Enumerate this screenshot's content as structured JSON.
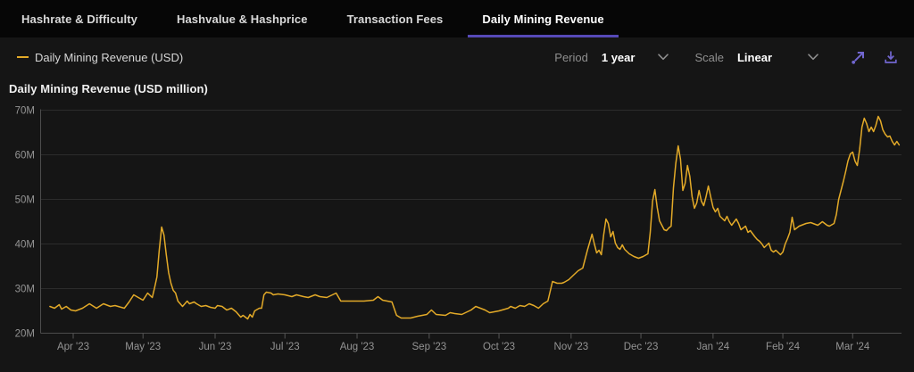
{
  "tabs": [
    {
      "label": "Hashrate & Difficulty",
      "active": false
    },
    {
      "label": "Hashvalue & Hashprice",
      "active": false
    },
    {
      "label": "Transaction Fees",
      "active": false
    },
    {
      "label": "Daily Mining Revenue",
      "active": true
    }
  ],
  "controls": {
    "period_label": "Period",
    "period_value": "1 year",
    "scale_label": "Scale",
    "scale_value": "Linear"
  },
  "colors": {
    "accent_purple": "#5649b8",
    "icon_purple": "#7166cf",
    "line_gold": "#e3aa28",
    "tabbar_bg": "#060606",
    "page_bg": "#151515",
    "grid": "#2c2c2c",
    "axis": "#4c4c4c",
    "tick": "#565656",
    "axis_text": "#949494"
  },
  "chart_data": {
    "type": "line",
    "title": "Daily Mining Revenue (USD million)",
    "series_name": "Daily Mining Revenue (USD)",
    "line_color": "#e3aa28",
    "y_unit": "USD million",
    "ylim": [
      20,
      70
    ],
    "grid": "horizontal-only",
    "legend_position": "top-left",
    "y_ticks": [
      {
        "label": "70M",
        "value": 70
      },
      {
        "label": "60M",
        "value": 60
      },
      {
        "label": "50M",
        "value": 50
      },
      {
        "label": "40M",
        "value": 40
      },
      {
        "label": "30M",
        "value": 30
      },
      {
        "label": "20M",
        "value": 20
      }
    ],
    "x_domain_days": [
      -3,
      367
    ],
    "x_ticks": [
      {
        "label": "Apr '23",
        "day": 11
      },
      {
        "label": "May '23",
        "day": 41
      },
      {
        "label": "Jun '23",
        "day": 72
      },
      {
        "label": "Jul '23",
        "day": 102
      },
      {
        "label": "Aug '23",
        "day": 133
      },
      {
        "label": "Sep '23",
        "day": 164
      },
      {
        "label": "Oct '23",
        "day": 194
      },
      {
        "label": "Nov '23",
        "day": 225
      },
      {
        "label": "Dec '23",
        "day": 255
      },
      {
        "label": "Jan '24",
        "day": 286
      },
      {
        "label": "Feb '24",
        "day": 316
      },
      {
        "label": "Mar '24",
        "day": 346
      }
    ],
    "points_day_value": [
      [
        1,
        26
      ],
      [
        3,
        25.6
      ],
      [
        5,
        26.4
      ],
      [
        6,
        25.4
      ],
      [
        8,
        26
      ],
      [
        10,
        25.2
      ],
      [
        12,
        25
      ],
      [
        15,
        25.6
      ],
      [
        18,
        26.6
      ],
      [
        21,
        25.6
      ],
      [
        24,
        26.6
      ],
      [
        27,
        26
      ],
      [
        29,
        26.2
      ],
      [
        33,
        25.6
      ],
      [
        35,
        27
      ],
      [
        37,
        28.6
      ],
      [
        39,
        28
      ],
      [
        41,
        27.4
      ],
      [
        43,
        29
      ],
      [
        45,
        28
      ],
      [
        46,
        30.2
      ],
      [
        47,
        32.6
      ],
      [
        48,
        38.6
      ],
      [
        49,
        43.8
      ],
      [
        50,
        42
      ],
      [
        51,
        37.6
      ],
      [
        52,
        33.6
      ],
      [
        53,
        31.2
      ],
      [
        54,
        29.6
      ],
      [
        55,
        29
      ],
      [
        56,
        27.2
      ],
      [
        57,
        26.6
      ],
      [
        58,
        26
      ],
      [
        59,
        26.6
      ],
      [
        60,
        27.2
      ],
      [
        61,
        26.6
      ],
      [
        63,
        27
      ],
      [
        64,
        26.6
      ],
      [
        66,
        26
      ],
      [
        68,
        26.2
      ],
      [
        70,
        25.8
      ],
      [
        72,
        25.6
      ],
      [
        73,
        26.2
      ],
      [
        75,
        26
      ],
      [
        77,
        25.2
      ],
      [
        79,
        25.6
      ],
      [
        81,
        24.8
      ],
      [
        83,
        23.6
      ],
      [
        84,
        24
      ],
      [
        86,
        23.2
      ],
      [
        87,
        24.2
      ],
      [
        88,
        23.6
      ],
      [
        89,
        25
      ],
      [
        91,
        25.6
      ],
      [
        92,
        25.6
      ],
      [
        93,
        28.6
      ],
      [
        94,
        29.2
      ],
      [
        96,
        29
      ],
      [
        97,
        28.6
      ],
      [
        99,
        28.8
      ],
      [
        102,
        28.6
      ],
      [
        105,
        28.2
      ],
      [
        107,
        28.6
      ],
      [
        110,
        28.2
      ],
      [
        112,
        28
      ],
      [
        115,
        28.6
      ],
      [
        117,
        28.2
      ],
      [
        120,
        28
      ],
      [
        124,
        29
      ],
      [
        126,
        27.2
      ],
      [
        129,
        27.2
      ],
      [
        133,
        27.2
      ],
      [
        136,
        27.2
      ],
      [
        140,
        27.4
      ],
      [
        142,
        28.2
      ],
      [
        144,
        27.4
      ],
      [
        148,
        27
      ],
      [
        150,
        24
      ],
      [
        152,
        23.4
      ],
      [
        156,
        23.4
      ],
      [
        159,
        23.8
      ],
      [
        163,
        24.2
      ],
      [
        165,
        25.2
      ],
      [
        167,
        24.2
      ],
      [
        171,
        24
      ],
      [
        173,
        24.6
      ],
      [
        175,
        24.4
      ],
      [
        178,
        24.2
      ],
      [
        182,
        25.2
      ],
      [
        184,
        26
      ],
      [
        186,
        25.6
      ],
      [
        188,
        25.2
      ],
      [
        190,
        24.6
      ],
      [
        194,
        25
      ],
      [
        198,
        25.6
      ],
      [
        199,
        26
      ],
      [
        201,
        25.6
      ],
      [
        203,
        26.2
      ],
      [
        205,
        26
      ],
      [
        207,
        26.6
      ],
      [
        209,
        26.2
      ],
      [
        211,
        25.6
      ],
      [
        213,
        26.6
      ],
      [
        215,
        27.2
      ],
      [
        217,
        31.6
      ],
      [
        219,
        31.2
      ],
      [
        221,
        31.2
      ],
      [
        222,
        31.4
      ],
      [
        224,
        32
      ],
      [
        226,
        33
      ],
      [
        228,
        34
      ],
      [
        230,
        34.6
      ],
      [
        232,
        38.6
      ],
      [
        234,
        42.2
      ],
      [
        235,
        40
      ],
      [
        236,
        38
      ],
      [
        237,
        38.6
      ],
      [
        238,
        37.6
      ],
      [
        239,
        42
      ],
      [
        240,
        45.6
      ],
      [
        241,
        44.6
      ],
      [
        242,
        41.6
      ],
      [
        243,
        42.8
      ],
      [
        244,
        40.2
      ],
      [
        245,
        39.2
      ],
      [
        246,
        38.8
      ],
      [
        247,
        39.8
      ],
      [
        248,
        38.8
      ],
      [
        250,
        37.8
      ],
      [
        252,
        37.2
      ],
      [
        254,
        36.8
      ],
      [
        256,
        37.2
      ],
      [
        258,
        37.8
      ],
      [
        259,
        42.6
      ],
      [
        260,
        49.6
      ],
      [
        261,
        52.2
      ],
      [
        262,
        48.2
      ],
      [
        263,
        45.2
      ],
      [
        265,
        43.2
      ],
      [
        266,
        43
      ],
      [
        267,
        43.6
      ],
      [
        268,
        44
      ],
      [
        269,
        52.6
      ],
      [
        270,
        58
      ],
      [
        271,
        62
      ],
      [
        272,
        59
      ],
      [
        273,
        52
      ],
      [
        274,
        53.6
      ],
      [
        275,
        57.6
      ],
      [
        276,
        55.2
      ],
      [
        277,
        50.6
      ],
      [
        278,
        48
      ],
      [
        279,
        49.2
      ],
      [
        280,
        52
      ],
      [
        281,
        49.6
      ],
      [
        282,
        48.6
      ],
      [
        283,
        50.6
      ],
      [
        284,
        53
      ],
      [
        285,
        50.6
      ],
      [
        286,
        48.2
      ],
      [
        287,
        47.2
      ],
      [
        288,
        48
      ],
      [
        289,
        46.2
      ],
      [
        291,
        45.2
      ],
      [
        292,
        46.2
      ],
      [
        293,
        45
      ],
      [
        294,
        44.2
      ],
      [
        296,
        45.6
      ],
      [
        297,
        44.6
      ],
      [
        298,
        43.2
      ],
      [
        300,
        44
      ],
      [
        301,
        42.6
      ],
      [
        302,
        43
      ],
      [
        304,
        41.6
      ],
      [
        305,
        41
      ],
      [
        306,
        40.6
      ],
      [
        307,
        40
      ],
      [
        308,
        39.2
      ],
      [
        310,
        40.2
      ],
      [
        311,
        38.6
      ],
      [
        312,
        38.2
      ],
      [
        313,
        38.6
      ],
      [
        315,
        37.6
      ],
      [
        316,
        38.2
      ],
      [
        317,
        40
      ],
      [
        318,
        41.2
      ],
      [
        319,
        42.6
      ],
      [
        320,
        46
      ],
      [
        321,
        43.2
      ],
      [
        323,
        44
      ],
      [
        324,
        44.2
      ],
      [
        326,
        44.6
      ],
      [
        328,
        44.8
      ],
      [
        329,
        44.6
      ],
      [
        331,
        44.2
      ],
      [
        333,
        45
      ],
      [
        334,
        44.6
      ],
      [
        335,
        44.2
      ],
      [
        336,
        44
      ],
      [
        338,
        44.6
      ],
      [
        339,
        46.6
      ],
      [
        340,
        50
      ],
      [
        341,
        52
      ],
      [
        342,
        54
      ],
      [
        343,
        56.2
      ],
      [
        344,
        58.6
      ],
      [
        345,
        60.2
      ],
      [
        346,
        60.6
      ],
      [
        347,
        58.6
      ],
      [
        348,
        57.6
      ],
      [
        349,
        61.2
      ],
      [
        350,
        66.2
      ],
      [
        351,
        68.2
      ],
      [
        352,
        67
      ],
      [
        353,
        65.2
      ],
      [
        354,
        66.2
      ],
      [
        355,
        65.2
      ],
      [
        356,
        66.6
      ],
      [
        357,
        68.6
      ],
      [
        358,
        67.6
      ],
      [
        359,
        65.6
      ],
      [
        360,
        64.6
      ],
      [
        361,
        64
      ],
      [
        362,
        64.2
      ],
      [
        363,
        63
      ],
      [
        364,
        62.2
      ],
      [
        365,
        63
      ],
      [
        366,
        62.2
      ]
    ]
  }
}
